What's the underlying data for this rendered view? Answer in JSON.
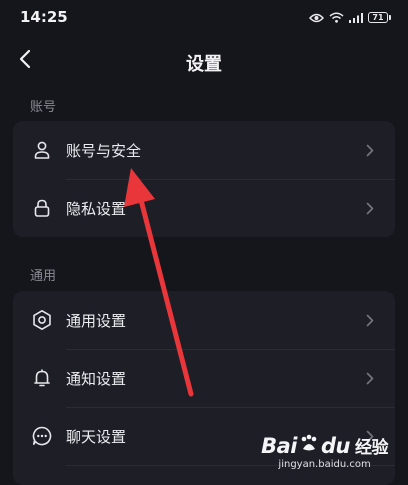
{
  "status_bar": {
    "time": "14:25",
    "battery": "71",
    "icons": [
      "eye-icon",
      "wifi-icon",
      "signal-icon",
      "battery-icon"
    ]
  },
  "nav": {
    "back_icon": "chevron-left-icon",
    "title": "设置"
  },
  "sections": [
    {
      "label": "账号",
      "items": [
        {
          "label": "账号与安全",
          "icon": "user-icon"
        },
        {
          "label": "隐私设置",
          "icon": "lock-icon"
        }
      ]
    },
    {
      "label": "通用",
      "items": [
        {
          "label": "通用设置",
          "icon": "gear-icon"
        },
        {
          "label": "通知设置",
          "icon": "bell-icon"
        },
        {
          "label": "聊天设置",
          "icon": "chat-bubble-icon"
        }
      ]
    }
  ],
  "watermark": {
    "brand": "Bai",
    "brand_suffix": "du",
    "brand_cn": "经验",
    "url": "jingyan.baidu.com"
  },
  "colors": {
    "background": "#15151c",
    "card": "#1e1e27",
    "text": "#ececf0",
    "muted": "#8a8a93",
    "annotation_arrow": "#e8363a"
  }
}
